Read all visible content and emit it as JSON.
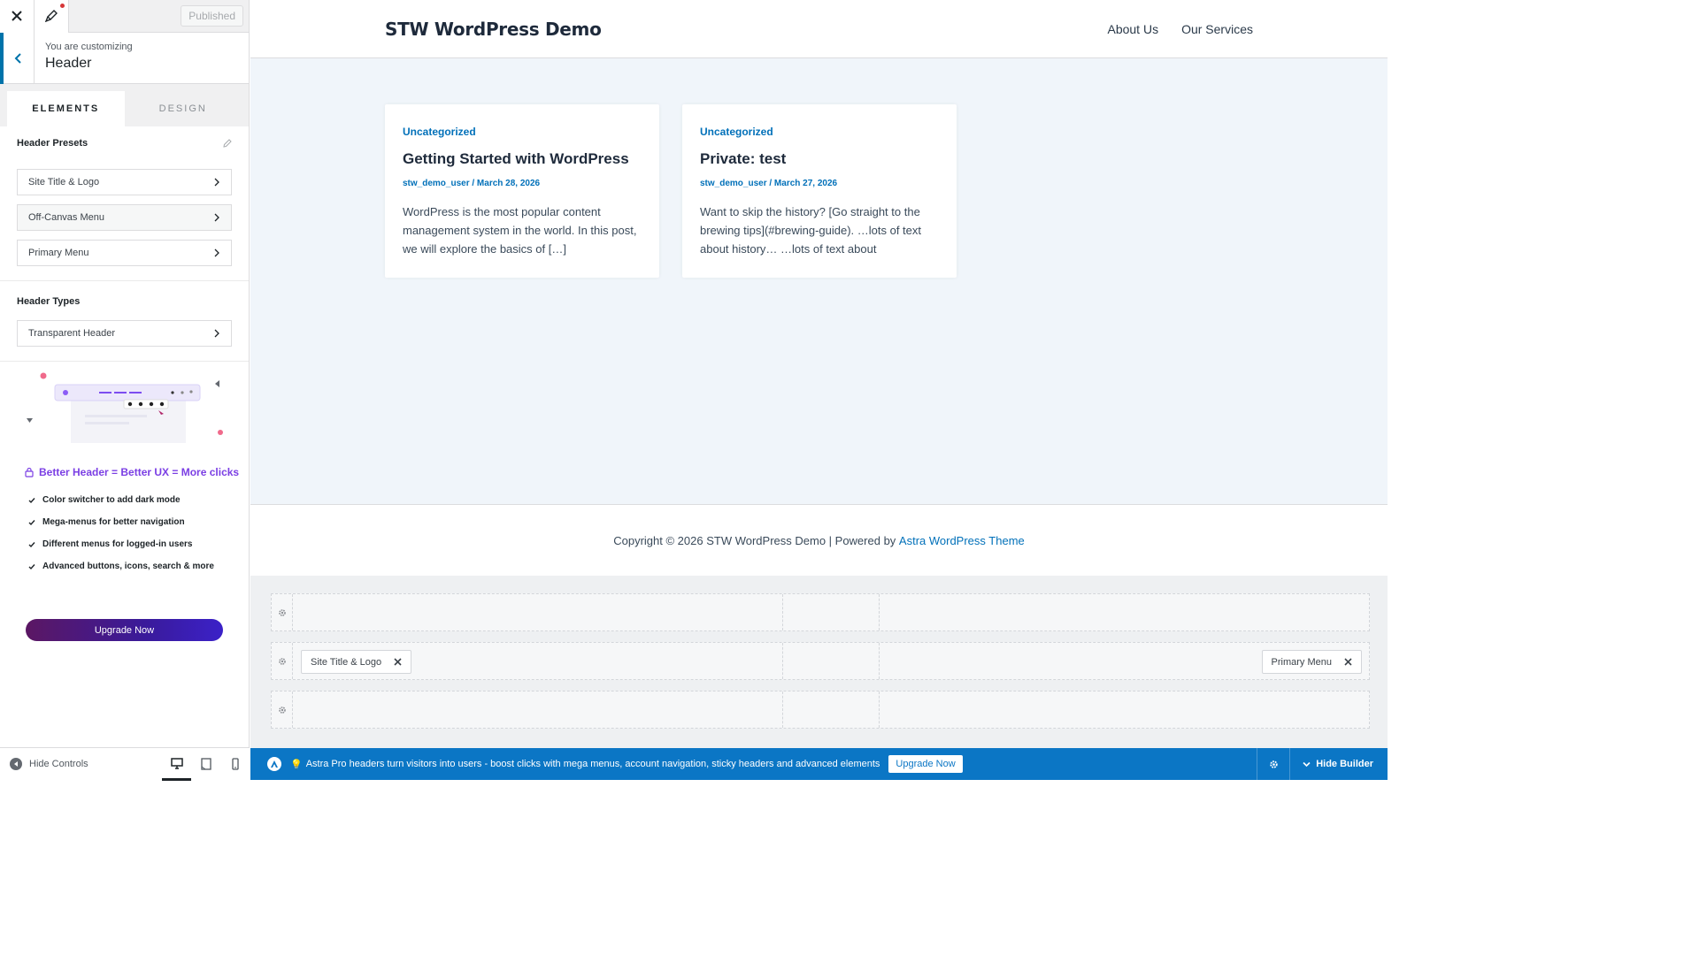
{
  "panel": {
    "published_label": "Published",
    "customizing_label": "You are customizing",
    "section_title": "Header",
    "tabs": [
      {
        "label": "ELEMENTS",
        "active": true
      },
      {
        "label": "DESIGN",
        "active": false
      }
    ],
    "presets": {
      "title": "Header Presets",
      "items": [
        "Site Title & Logo",
        "Off-Canvas Menu",
        "Primary Menu"
      ]
    },
    "types": {
      "title": "Header Types",
      "items": [
        "Transparent Header"
      ]
    },
    "promo": {
      "title": "Better Header = Better UX = More clicks",
      "features": [
        "Color switcher to add dark mode",
        "Mega-menus for better navigation",
        "Different menus for logged-in users",
        "Advanced buttons, icons, search & more"
      ],
      "button": "Upgrade Now"
    },
    "footer": {
      "hide_controls": "Hide Controls"
    }
  },
  "site": {
    "title": "STW WordPress Demo",
    "nav": [
      "About Us",
      "Our Services"
    ],
    "posts": [
      {
        "category": "Uncategorized",
        "title": "Getting Started with WordPress",
        "meta": "stw_demo_user / March 28, 2026",
        "excerpt": "WordPress is the most popular content management system in the world. In this post, we will explore the basics of […]"
      },
      {
        "category": "Uncategorized",
        "title": "Private: test",
        "meta": "stw_demo_user / March 27, 2026",
        "excerpt": "Want to skip the history? [Go straight to the brewing tips](#brewing-guide). …lots of text about history… …lots of text about"
      }
    ],
    "footer": {
      "copyright": "Copyright © 2026 STW WordPress Demo | Powered by ",
      "link": "Astra WordPress Theme"
    }
  },
  "builder": {
    "items": {
      "site_title_logo": "Site Title & Logo",
      "primary_menu": "Primary Menu"
    }
  },
  "bottombar": {
    "message": "Astra Pro headers turn visitors into users - boost clicks with mega menus, account navigation, sticky headers and advanced elements",
    "upgrade": "Upgrade Now",
    "hide_builder": "Hide Builder"
  },
  "colors": {
    "accent": "#0170b9",
    "bar": "#0b76c5",
    "promo": "#7b3fe4"
  }
}
